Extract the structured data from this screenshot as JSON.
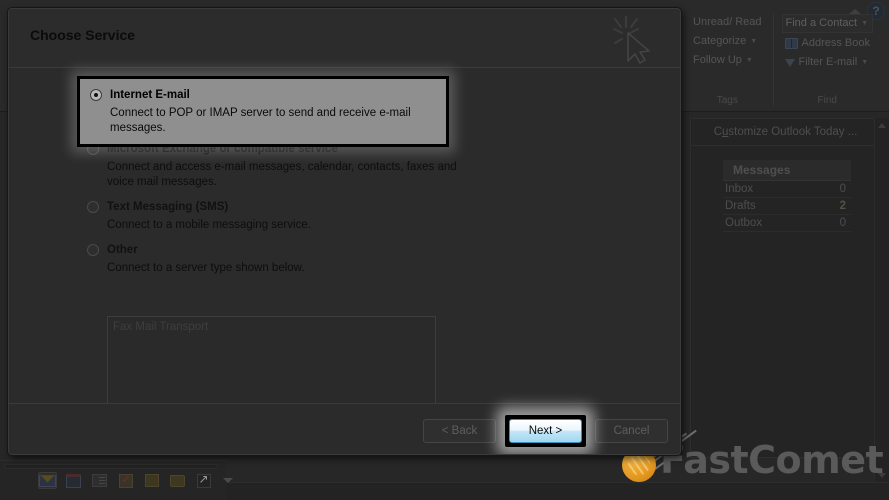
{
  "dialog": {
    "title": "Choose Service",
    "cursor_icon": "click-pointer-icon",
    "options": [
      {
        "label": "Internet E-mail",
        "description": "Connect to POP or IMAP server to send and receive e-mail messages.",
        "selected": true,
        "highlighted": true
      },
      {
        "label": "Microsoft Exchange or compatible service",
        "description": "Connect and access e-mail messages, calendar, contacts, faxes and voice mail messages.",
        "selected": false,
        "highlighted": false
      },
      {
        "label": "Text Messaging (SMS)",
        "description": "Connect to a mobile messaging service.",
        "selected": false,
        "highlighted": false
      },
      {
        "label": "Other",
        "description": "Connect to a server type shown below.",
        "selected": false,
        "highlighted": false
      }
    ],
    "listbox": {
      "items": [
        "Fax Mail Transport"
      ]
    },
    "buttons": {
      "back": "< Back",
      "next": "Next >",
      "cancel": "Cancel"
    }
  },
  "outlook": {
    "ribbon": {
      "collapse_icon": "chevron-up-icon",
      "help_label": "?",
      "groups": [
        {
          "name": "Tags",
          "items": [
            {
              "label": "Unread/ Read",
              "icon": "",
              "caret": false
            },
            {
              "label": "Categorize",
              "icon": "",
              "caret": true
            },
            {
              "label": "Follow Up",
              "icon": "",
              "caret": true
            }
          ]
        },
        {
          "name": "Find",
          "items": [
            {
              "label": "Find a Contact",
              "icon": "",
              "caret": true
            },
            {
              "label": "Address Book",
              "icon": "address-book-icon",
              "caret": false
            },
            {
              "label": "Filter E-mail",
              "icon": "funnel-icon",
              "caret": true
            }
          ]
        }
      ]
    },
    "today": {
      "customize_prefix": "C",
      "customize_underline": "u",
      "customize_suffix": "stomize Outlook Today ...",
      "messages_title": "Messages",
      "folders": [
        {
          "name": "Inbox",
          "count": "0",
          "bold": false
        },
        {
          "name": "Drafts",
          "count": "2",
          "bold": true
        },
        {
          "name": "Outbox",
          "count": "0",
          "bold": false
        }
      ]
    },
    "navbar": {
      "icons": [
        {
          "name": "mail-icon",
          "selected": true
        },
        {
          "name": "calendar-icon",
          "selected": false
        },
        {
          "name": "contacts-icon",
          "selected": false
        },
        {
          "name": "tasks-icon",
          "selected": false
        },
        {
          "name": "notes-icon",
          "selected": false
        },
        {
          "name": "folder-list-icon",
          "selected": false
        },
        {
          "name": "shortcuts-icon",
          "selected": false
        }
      ],
      "overflow_icon": "chevron-down-icon"
    }
  },
  "watermark": {
    "brand": "FastComet",
    "accent_color": "#e59a22",
    "text_color": "#5a5a5a"
  }
}
